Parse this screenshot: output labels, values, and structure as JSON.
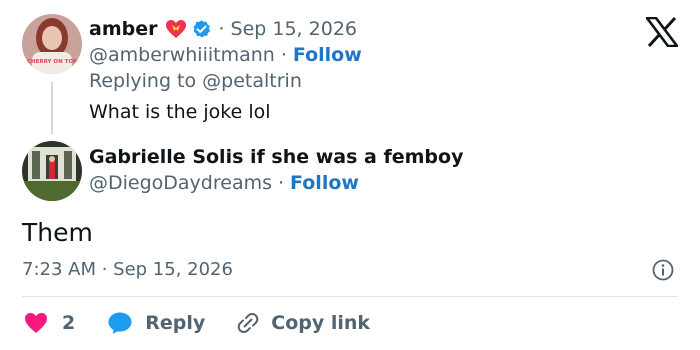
{
  "reply_to_tweet": {
    "author": {
      "name": "amber",
      "handle": "@amberwhiiitmann",
      "verified": true,
      "name_emoji": "heart-with-ribbon-icon",
      "avatar_caption": "CHERRY ON TOP"
    },
    "date": "Sep 15, 2026",
    "follow_label": "Follow",
    "replying_to": "Replying to @petaltrin",
    "text": "What is the joke lol"
  },
  "tweet": {
    "author": {
      "name": "Gabrielle Solis if she was a femboy",
      "handle": "@DiegoDaydreams"
    },
    "follow_label": "Follow",
    "text": "Them",
    "timestamp": "7:23 AM · Sep 15, 2026"
  },
  "actions": {
    "like_count": "2",
    "reply_label": "Reply",
    "copy_label": "Copy link"
  },
  "separator": "·",
  "colors": {
    "follow": "#1d76c7",
    "muted": "#536471",
    "like": "#f91880",
    "reply": "#1d9bf0",
    "verified": "#1d9bf0"
  },
  "icons": [
    "x-logo-icon",
    "verified-badge-icon",
    "heart-with-ribbon-icon",
    "info-icon",
    "heart-icon",
    "reply-bubble-icon",
    "link-icon"
  ]
}
